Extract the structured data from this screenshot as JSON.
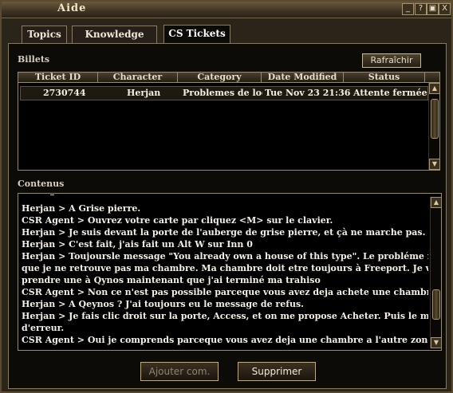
{
  "window": {
    "title": "Aide",
    "buttons": [
      "_",
      "?",
      "▣",
      "X"
    ]
  },
  "tabs": [
    {
      "label": "Topics",
      "active": false
    },
    {
      "label": "Knowledge Base",
      "active": false
    },
    {
      "label": "CS Tickets",
      "active": true
    }
  ],
  "tickets": {
    "section_label": "Billets",
    "refresh_label": "Rafraîchir",
    "columns": [
      "Ticket ID",
      "Character",
      "Category",
      "Date Modified",
      "Status"
    ],
    "rows": [
      {
        "ticket_id": "2730744",
        "character": "Herjan",
        "category": "Problemes de loge..",
        "date_modified": "Tue Nov 23 21:36:..",
        "status": "Attente fermée"
      }
    ]
  },
  "content": {
    "section_label": "Contenus",
    "lines": [
      "Herjan > A Grise pierre.",
      "CSR Agent > Ouvrez votre carte par cliquez <M> sur le clavier.",
      "Herjan > Je suis devant la porte de l'auberge de grise pierre, et çà ne marche pas.",
      "Herjan > C'est fait, j'ais fait un Alt W sur Inn 0",
      "Herjan > Toujoursle message \"You already own a house of this type\". Le probléme n'est pas",
      "que je ne retrouve pas ma chambre. Ma chambre doit etre toujours à Freeport. Je voudrais en",
      "prendre une à Qynos maintenant que j'ai terminé ma trahiso",
      "CSR Agent > Non ce n'est pas possible parceque vous avez deja achete une chambre.",
      "Herjan > A Qeynos ? J'ai toujours eu le message de refus.",
      "Herjan > Je fais clic droit sur la porte, Access, et on me propose Acheter. Puis le message",
      "d'erreur.",
      "CSR Agent > Oui je comprends parceque vous avez deja une chambre a l'autre zone."
    ]
  },
  "footer": {
    "add_comment_label": "Ajouter com.",
    "delete_label": "Supprimer"
  },
  "colors": {
    "frame": "#5a4a31",
    "text": "#f4f0e4",
    "button_border": "#c7a96a",
    "disabled_text": "#8c8470"
  }
}
